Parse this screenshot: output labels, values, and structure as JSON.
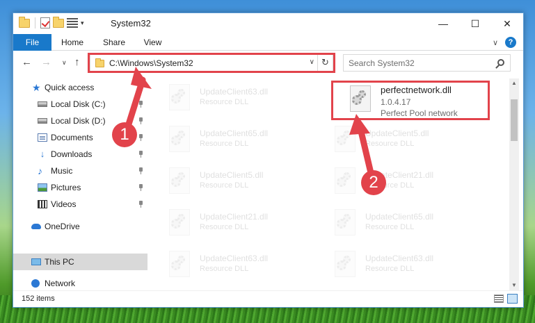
{
  "window": {
    "title": "System32",
    "minimize_glyph": "—",
    "maximize_glyph": "☐",
    "close_glyph": "✕"
  },
  "ribbon": {
    "tabs": [
      {
        "label": "File"
      },
      {
        "label": "Home"
      },
      {
        "label": "Share"
      },
      {
        "label": "View"
      }
    ],
    "collapse_glyph": "∨",
    "help_glyph": "?"
  },
  "address": {
    "path": "C:\\Windows\\System32",
    "dropdown_glyph": "∨",
    "refresh_glyph": "↻"
  },
  "navigation": {
    "back_glyph": "←",
    "forward_glyph": "→",
    "recent_glyph": "∨",
    "up_glyph": "↑"
  },
  "search": {
    "placeholder": "Search System32"
  },
  "sidebar": {
    "items": [
      {
        "label": "Quick access"
      },
      {
        "label": "Local Disk (C:)"
      },
      {
        "label": "Local Disk (D:)"
      },
      {
        "label": "Documents"
      },
      {
        "label": "Downloads"
      },
      {
        "label": "Music"
      },
      {
        "label": "Pictures"
      },
      {
        "label": "Videos"
      },
      {
        "label": "OneDrive"
      },
      {
        "label": "This PC"
      },
      {
        "label": "Network"
      }
    ],
    "icons": {
      "quick_access": "★",
      "downloads": "↓",
      "music": "♪"
    }
  },
  "files": {
    "highlighted": {
      "name": "perfectnetwork.dll",
      "version": "1.0.4.17",
      "description": "Perfect Pool network"
    },
    "faded": [
      {
        "name": "UpdateClient63.dll",
        "description": "Resource DLL"
      },
      {
        "name": "UpdateClient65.dll",
        "description": "Resource DLL"
      },
      {
        "name": "UpdateClient5.dll",
        "description": "Resource DLL"
      },
      {
        "name": "UpdateClient21.dll",
        "description": "Resource DLL"
      },
      {
        "name": "UpdateClient63.dll",
        "description": "Resource DLL"
      },
      {
        "name": "UpdateClient5.dll",
        "description": "Resource DLL"
      },
      {
        "name": "UpdateClient21.dll",
        "description": "Resource DLL"
      },
      {
        "name": "UpdateClient65.dll",
        "description": "Resource DLL"
      },
      {
        "name": "UpdateClient63.dll",
        "description": "Resource DLL"
      }
    ]
  },
  "scrollbar": {
    "up_glyph": "▲",
    "down_glyph": "▼"
  },
  "status": {
    "item_count": "152 items"
  },
  "callouts": [
    {
      "label": "1"
    },
    {
      "label": "2"
    }
  ],
  "colors": {
    "accent": "#1979ca",
    "highlight": "#e2434b"
  }
}
